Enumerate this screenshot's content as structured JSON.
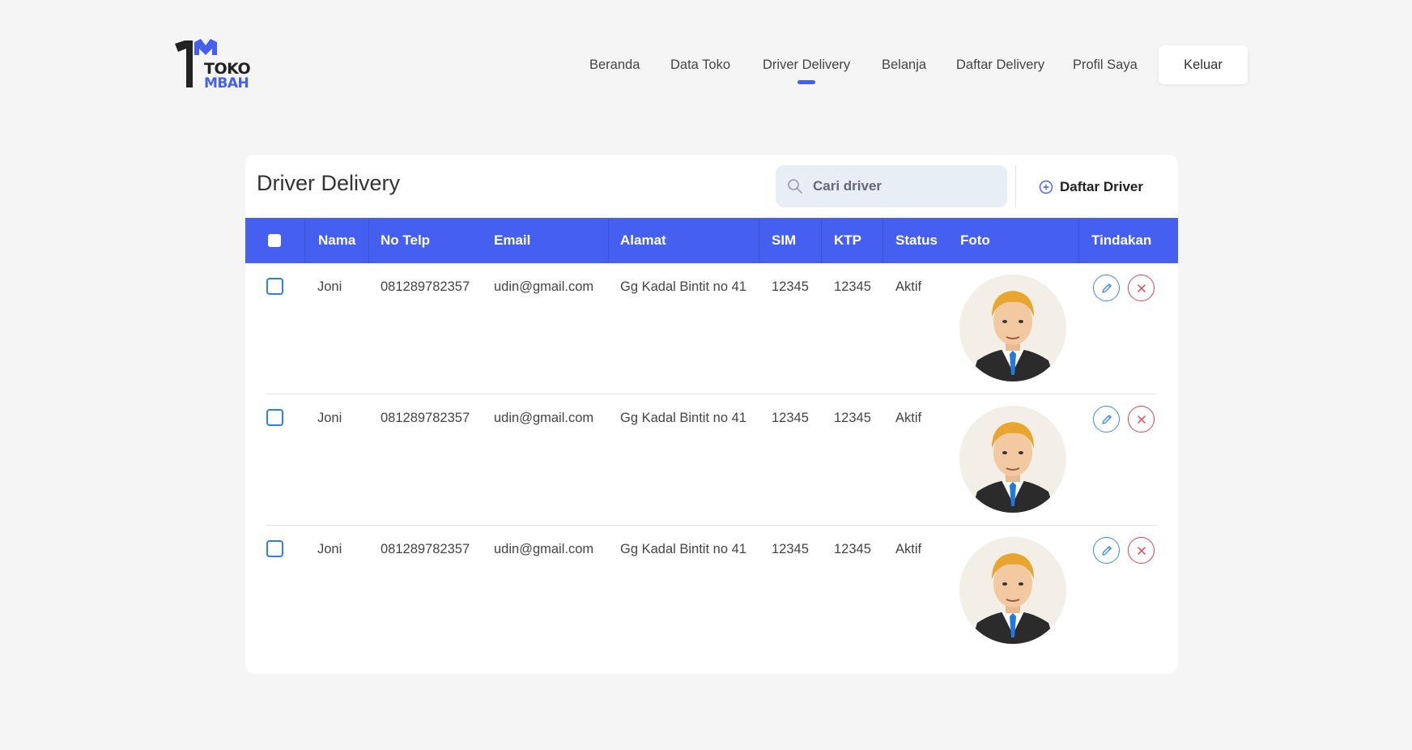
{
  "brand": {
    "line1": "TOKO",
    "line2": "MBAH"
  },
  "nav": {
    "items": [
      {
        "label": "Beranda"
      },
      {
        "label": "Data Toko"
      },
      {
        "label": "Driver Delivery",
        "active": true
      },
      {
        "label": "Belanja"
      },
      {
        "label": "Daftar Delivery"
      },
      {
        "label": "Profil Saya"
      }
    ],
    "logout_label": "Keluar"
  },
  "page": {
    "title": "Driver Delivery",
    "search_placeholder": "Cari driver",
    "add_label": "Daftar Driver"
  },
  "table": {
    "columns": [
      "Nama",
      "No Telp",
      "Email",
      "Alamat",
      "SIM",
      "KTP",
      "Status",
      "Foto",
      "Tindakan"
    ],
    "rows": [
      {
        "nama": "Joni",
        "telp": "081289782357",
        "email": "udin@gmail.com",
        "alamat": "Gg Kadal Bintit no 41",
        "sim": "12345",
        "ktp": "12345",
        "status": "Aktif"
      },
      {
        "nama": "Joni",
        "telp": "081289782357",
        "email": "udin@gmail.com",
        "alamat": "Gg Kadal Bintit no 41",
        "sim": "12345",
        "ktp": "12345",
        "status": "Aktif"
      },
      {
        "nama": "Joni",
        "telp": "081289782357",
        "email": "udin@gmail.com",
        "alamat": "Gg Kadal Bintit no 41",
        "sim": "12345",
        "ktp": "12345",
        "status": "Aktif"
      }
    ]
  },
  "colors": {
    "accent": "#4560f0",
    "edit": "#3d8be0",
    "delete": "#e0424f"
  },
  "icons": {
    "search": "search-icon",
    "add": "plus-circle-icon",
    "edit": "pencil-icon",
    "delete": "close-icon",
    "avatar": "avatar-man-icon"
  }
}
